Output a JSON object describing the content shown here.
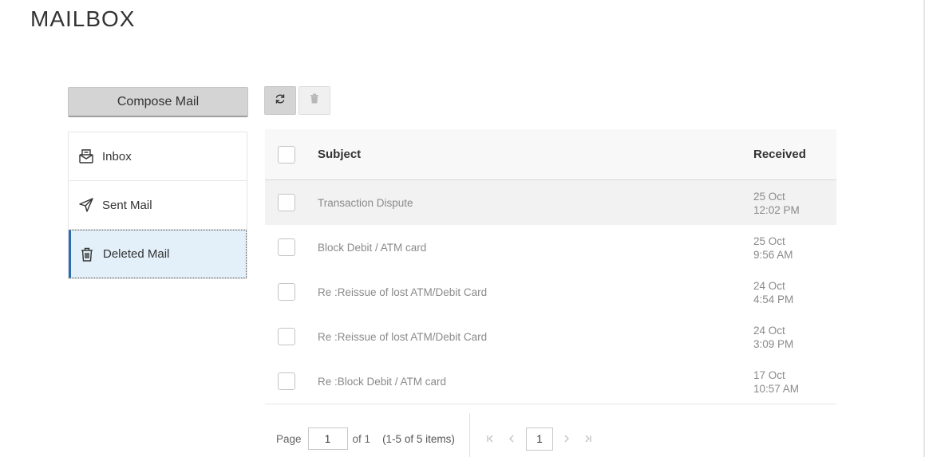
{
  "page": {
    "title": "MAILBOX"
  },
  "compose": {
    "label": "Compose Mail"
  },
  "folders": [
    {
      "label": "Inbox",
      "icon": "inbox-icon",
      "active": false
    },
    {
      "label": "Sent Mail",
      "icon": "send-icon",
      "active": false
    },
    {
      "label": "Deleted Mail",
      "icon": "trash-icon",
      "active": true
    }
  ],
  "toolbar": {
    "refresh_icon": "refresh-icon",
    "delete_icon": "trash-icon"
  },
  "table": {
    "headers": {
      "subject": "Subject",
      "received": "Received"
    },
    "rows": [
      {
        "subject": "Transaction Dispute",
        "date": "25 Oct",
        "time": "12:02 PM"
      },
      {
        "subject": "Block Debit / ATM card",
        "date": "25 Oct",
        "time": "9:56 AM"
      },
      {
        "subject": "Re :Reissue of lost ATM/Debit Card",
        "date": "24 Oct",
        "time": "4:54 PM"
      },
      {
        "subject": "Re :Reissue of lost ATM/Debit Card",
        "date": "24 Oct",
        "time": "3:09 PM"
      },
      {
        "subject": "Re :Block Debit / ATM card",
        "date": "17 Oct",
        "time": "10:57 AM"
      }
    ]
  },
  "pager": {
    "page_label": "Page",
    "page_value": "1",
    "of_label": "of 1",
    "count_label": "(1-5 of 5 items)",
    "current_page": "1"
  },
  "colors": {
    "accent": "#2b6cb0",
    "active_bg": "#e3f0fa",
    "muted_text": "#8a8a8a"
  }
}
